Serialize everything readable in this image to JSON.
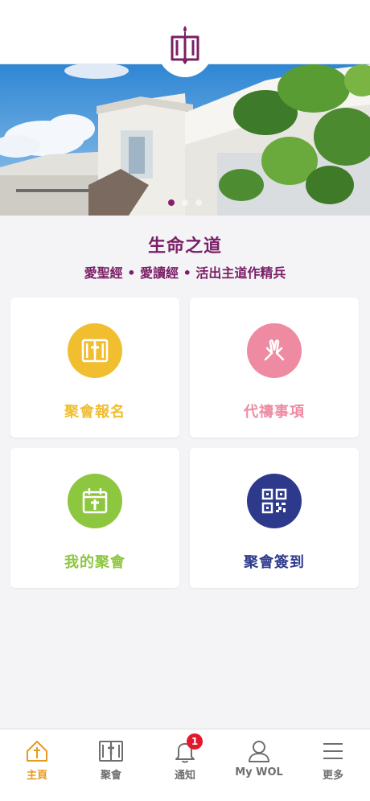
{
  "header": {
    "logo_icon": "church-candle-logo-icon"
  },
  "banner": {
    "slides": 3,
    "active_slide": 1
  },
  "brand": {
    "title": "生命之道",
    "tagline": "愛聖經 • 愛讀經 • 活出主道作精兵",
    "color": "#7a1f66"
  },
  "menu": [
    {
      "label": "聚會報名",
      "icon": "bible-icon",
      "color": "#f0be2e"
    },
    {
      "label": "代禱事項",
      "icon": "praying-hands-icon",
      "color": "#ee8ba2"
    },
    {
      "label": "我的聚會",
      "icon": "calendar-cross-icon",
      "color": "#8dc63f"
    },
    {
      "label": "聚會簽到",
      "icon": "qr-code-icon",
      "color": "#2d3a8c"
    }
  ],
  "tabbar": [
    {
      "label": "主頁",
      "icon": "home-cross-icon",
      "active": true
    },
    {
      "label": "聚會",
      "icon": "bible-icon",
      "active": false
    },
    {
      "label": "通知",
      "icon": "bell-icon",
      "badge": "1",
      "active": false
    },
    {
      "label": "My WOL",
      "icon": "user-icon",
      "active": false
    },
    {
      "label": "更多",
      "icon": "menu-icon",
      "active": false
    }
  ]
}
